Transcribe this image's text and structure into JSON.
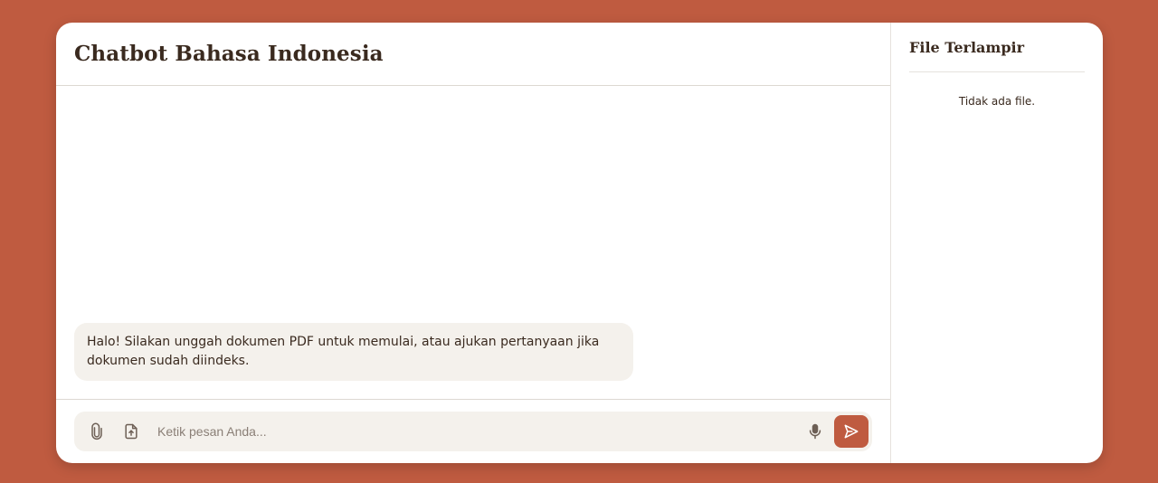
{
  "chat": {
    "title": "Chatbot Bahasa Indonesia",
    "messages": [
      {
        "role": "bot",
        "text": "Halo! Silakan unggah dokumen PDF untuk memulai, atau ajukan pertanyaan jika dokumen sudah diindeks."
      }
    ],
    "composer": {
      "placeholder": "Ketik pesan Anda...",
      "value": "",
      "attach_icon": "paperclip-icon",
      "upload_icon": "file-upload-icon",
      "mic_icon": "microphone-icon",
      "send_icon": "send-icon"
    }
  },
  "sidebar": {
    "title": "File Terlampir",
    "empty_text": "Tidak ada file."
  },
  "colors": {
    "background": "#bf5b40",
    "accent": "#bf5b40",
    "bubble": "#f4f1ec",
    "text": "#3a2a1f"
  }
}
